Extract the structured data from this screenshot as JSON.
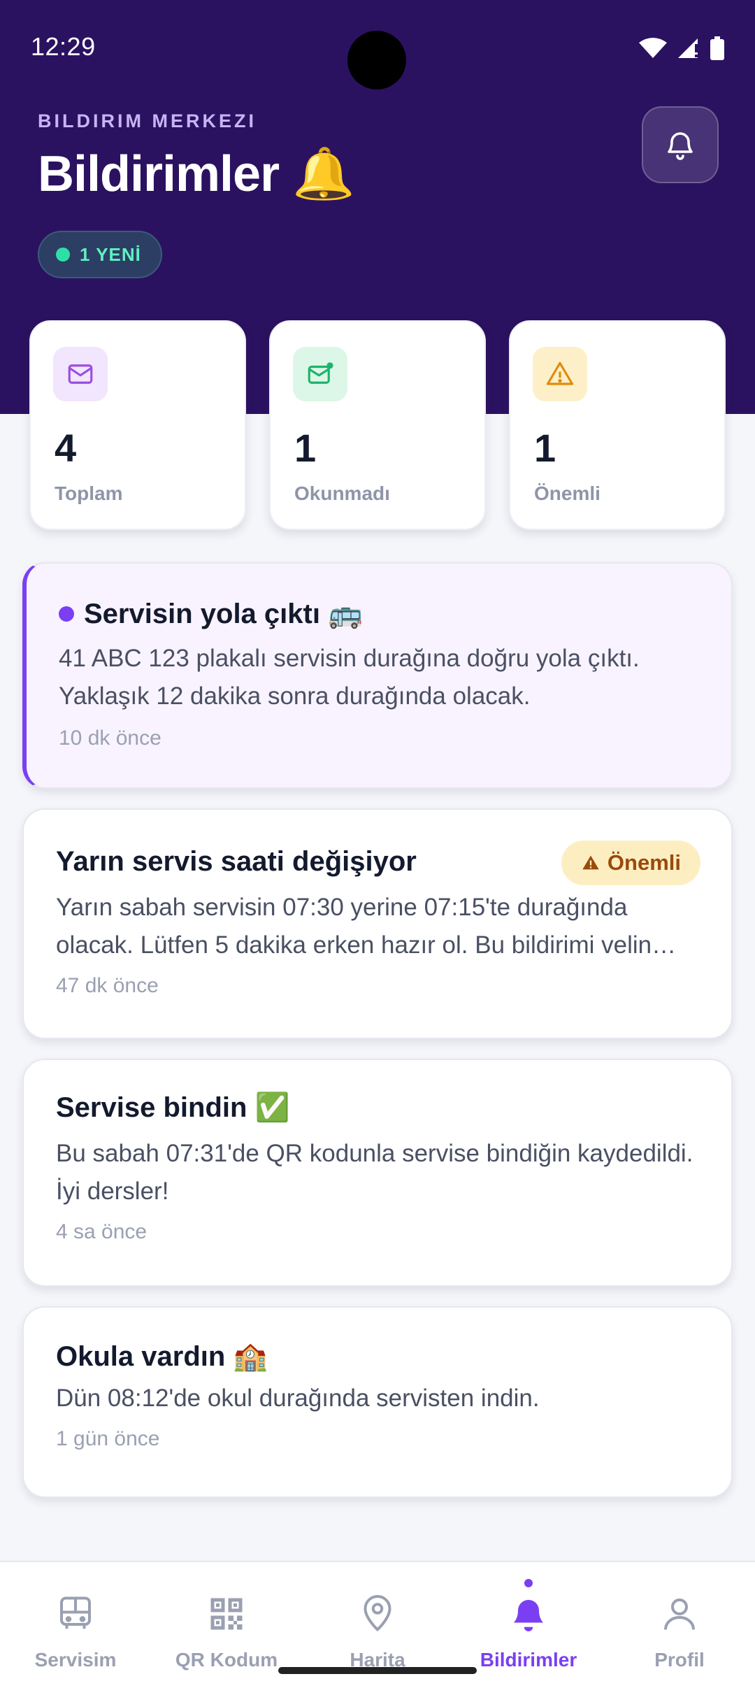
{
  "status_bar": {
    "time": "12:29"
  },
  "header": {
    "eyebrow": "BILDIRIM MERKEZI",
    "title": "Bildirimler 🔔",
    "new_badge": "1 YENİ"
  },
  "stats": [
    {
      "value": "4",
      "label": "Toplam",
      "icon": "mail-icon",
      "bg": "#f1e6fd",
      "color": "#9b4de0"
    },
    {
      "value": "1",
      "label": "Okunmadı",
      "icon": "mail-unread-icon",
      "bg": "#dcf7e7",
      "color": "#1db46a"
    },
    {
      "value": "1",
      "label": "Önemli",
      "icon": "warning-icon",
      "bg": "#fdf0c8",
      "color": "#e08a0b"
    }
  ],
  "notifications": [
    {
      "title": "Servisin yola çıktı 🚌",
      "body": "41 ABC 123 plakalı servisin durağına doğru yola çıktı. Yaklaşık 12 dakika sonra durağında olacak.",
      "time": "10 dk önce",
      "unread": true
    },
    {
      "title": "Yarın servis saati değişiyor",
      "body_line1": "Yarın sabah servisin 07:30 yerine 07:15'te durağında",
      "body_line2": "olacak. Lütfen 5 dakika erken hazır ol. Bu bildirimi velin…",
      "time": "47 dk önce",
      "badge": "Önemli"
    },
    {
      "title": "Servise bindin ✅",
      "body": "Bu sabah 07:31'de QR kodunla servise bindiğin kaydedildi. İyi dersler!",
      "time": "4 sa önce"
    },
    {
      "title": "Okula vardın 🏫",
      "body": "Dün 08:12'de okul durağında servisten indin.",
      "time": "1 gün önce"
    }
  ],
  "bottom_nav": [
    {
      "label": "Servisim",
      "icon": "bus-icon"
    },
    {
      "label": "QR Kodum",
      "icon": "qr-code-icon"
    },
    {
      "label": "Harita",
      "icon": "map-pin-icon"
    },
    {
      "label": "Bildirimler",
      "icon": "bell-icon",
      "active": true
    },
    {
      "label": "Profil",
      "icon": "profile-icon"
    }
  ]
}
